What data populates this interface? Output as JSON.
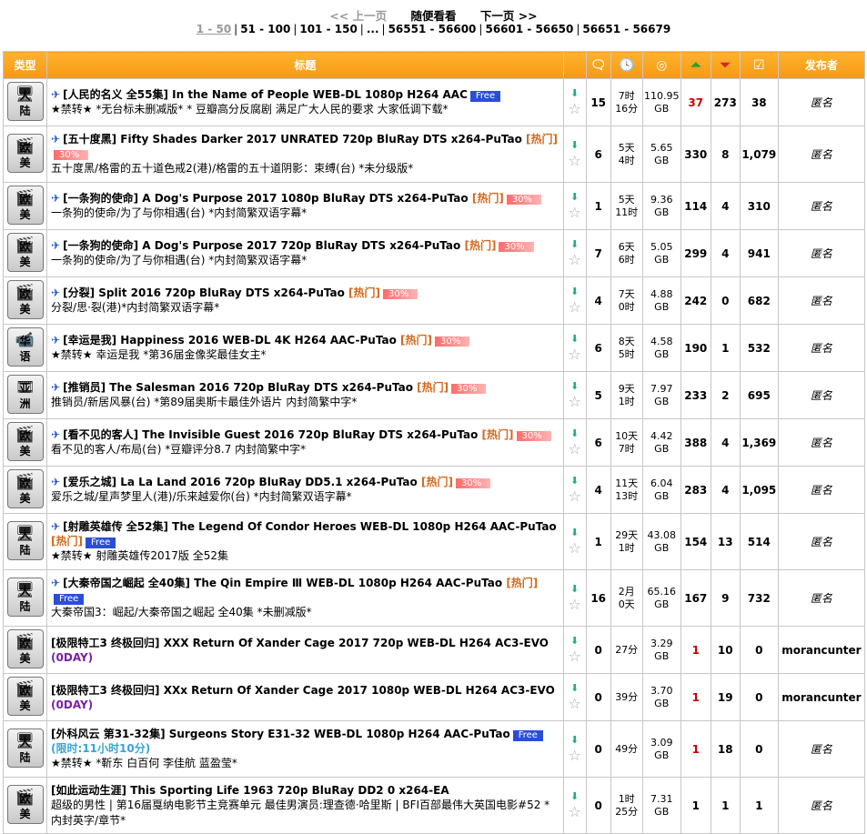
{
  "pager": {
    "prev": "<< 上一页",
    "random": "随便看看",
    "next": "下一页 >>",
    "pages": [
      "1 - 50",
      "51 - 100",
      "101 - 150",
      "...",
      "56551 - 56600",
      "56601 - 56650",
      "56651 - 56679"
    ]
  },
  "header": {
    "type": "类型",
    "title": "标题",
    "uploader": "发布者",
    "icons": [
      "comments-icon",
      "time-icon",
      "size-icon",
      "seeders-icon",
      "leechers-icon",
      "completed-icon"
    ]
  },
  "rows": [
    {
      "cat_icon": "tv-icon",
      "cat": "大陆",
      "title": "[人民的名义 全55集] In the Name of People WEB-DL 1080p H264 AAC",
      "hot": "",
      "free": "Free",
      "pct": "",
      "oday": "",
      "limit": "",
      "sub": "★禁转★ *无台标未删减版* * 豆瓣高分反腐剧 满足广大人民的要求 大家低调下载*",
      "comments": "15",
      "time1": "7时",
      "time2": "16分",
      "size1": "110.95",
      "size2": "GB",
      "seed": "37",
      "seed_red": true,
      "leech": "273",
      "done": "38",
      "uploader": "匿名"
    },
    {
      "cat_icon": "movie-icon",
      "cat": "欧美",
      "title": "[五十度黑] Fifty Shades Darker 2017 UNRATED 720p BluRay DTS x264-PuTao",
      "hot": "[热门]",
      "free": "",
      "pct": "30%",
      "oday": "",
      "limit": "",
      "sub": "五十度黑/格雷的五十道色戒2(港)/格雷的五十道阴影：束缚(台) *未分级版*",
      "comments": "6",
      "time1": "5天",
      "time2": "4时",
      "size1": "5.65",
      "size2": "GB",
      "seed": "330",
      "seed_red": false,
      "leech": "8",
      "done": "1,079",
      "uploader": "匿名"
    },
    {
      "cat_icon": "movie-icon",
      "cat": "欧美",
      "title": "[一条狗的使命] A Dog's Purpose 2017 1080p BluRay DTS x264-PuTao",
      "hot": "[热门]",
      "free": "",
      "pct": "30%",
      "oday": "",
      "limit": "",
      "sub": "一条狗的使命/为了与你相遇(台) *内封简繁双语字幕*",
      "comments": "1",
      "time1": "5天",
      "time2": "11时",
      "size1": "9.36",
      "size2": "GB",
      "seed": "114",
      "seed_red": false,
      "leech": "4",
      "done": "310",
      "uploader": "匿名"
    },
    {
      "cat_icon": "movie-icon",
      "cat": "欧美",
      "title": "[一条狗的使命] A Dog's Purpose 2017 720p BluRay DTS x264-PuTao",
      "hot": "[热门]",
      "free": "",
      "pct": "30%",
      "oday": "",
      "limit": "",
      "sub": "一条狗的使命/为了与你相遇(台) *内封简繁双语字幕*",
      "comments": "7",
      "time1": "6天",
      "time2": "6时",
      "size1": "5.05",
      "size2": "GB",
      "seed": "299",
      "seed_red": false,
      "leech": "4",
      "done": "941",
      "uploader": "匿名"
    },
    {
      "cat_icon": "movie-icon",
      "cat": "欧美",
      "title": "[分裂] Split 2016 720p BluRay DTS x264-PuTao",
      "hot": "[热门]",
      "free": "",
      "pct": "30%",
      "oday": "",
      "limit": "",
      "sub": "分裂/思·裂(港)*内封简繁双语字幕*",
      "comments": "4",
      "time1": "7天",
      "time2": "0时",
      "size1": "4.88",
      "size2": "GB",
      "seed": "242",
      "seed_red": false,
      "leech": "0",
      "done": "682",
      "uploader": "匿名"
    },
    {
      "cat_icon": "camera-icon",
      "cat": "华语",
      "title": "[幸运是我] Happiness 2016 WEB-DL 4K H264 AAC-PuTao",
      "hot": "[热门]",
      "free": "",
      "pct": "30%",
      "oday": "",
      "limit": "",
      "sub": "★禁转★ 幸运是我 *第36届金像奖最佳女主*",
      "comments": "6",
      "time1": "8天",
      "time2": "5时",
      "size1": "4.58",
      "size2": "GB",
      "seed": "190",
      "seed_red": false,
      "leech": "1",
      "done": "532",
      "uploader": "匿名"
    },
    {
      "cat_icon": "film-icon",
      "cat": "亚洲",
      "title": "[推销员] The Salesman 2016 720p BluRay DTS x264-PuTao",
      "hot": "[热门]",
      "free": "",
      "pct": "30%",
      "oday": "",
      "limit": "",
      "sub": "推销员/新居风暴(台) *第89届奥斯卡最佳外语片 内封简繁中字*",
      "comments": "5",
      "time1": "9天",
      "time2": "1时",
      "size1": "7.97",
      "size2": "GB",
      "seed": "233",
      "seed_red": false,
      "leech": "2",
      "done": "695",
      "uploader": "匿名"
    },
    {
      "cat_icon": "movie-icon",
      "cat": "欧美",
      "title": "[看不见的客人] The Invisible Guest 2016 720p BluRay DTS x264-PuTao",
      "hot": "[热门]",
      "free": "",
      "pct": "30%",
      "oday": "",
      "limit": "",
      "sub": "看不见的客人/布局(台) *豆瓣评分8.7 内封简繁中字*",
      "comments": "6",
      "time1": "10天",
      "time2": "7时",
      "size1": "4.42",
      "size2": "GB",
      "seed": "388",
      "seed_red": false,
      "leech": "4",
      "done": "1,369",
      "uploader": "匿名"
    },
    {
      "cat_icon": "movie-icon",
      "cat": "欧美",
      "title": "[爱乐之城] La La Land 2016 720p BluRay DD5.1 x264-PuTao",
      "hot": "[热门]",
      "free": "",
      "pct": "30%",
      "oday": "",
      "limit": "",
      "sub": "爱乐之城/星声梦里人(港)/乐来越爱你(台) *内封简繁双语字幕*",
      "comments": "4",
      "time1": "11天",
      "time2": "13时",
      "size1": "6.04",
      "size2": "GB",
      "seed": "283",
      "seed_red": false,
      "leech": "4",
      "done": "1,095",
      "uploader": "匿名"
    },
    {
      "cat_icon": "tv-icon",
      "cat": "大陆",
      "title": "[射雕英雄传 全52集] The Legend Of Condor Heroes WEB-DL 1080p H264 AAC-PuTao",
      "hot": "[热门]",
      "free": "Free",
      "pct": "",
      "oday": "",
      "limit": "",
      "sub": "★禁转★ 射雕英雄传2017版 全52集",
      "comments": "1",
      "time1": "29天",
      "time2": "1时",
      "size1": "43.08",
      "size2": "GB",
      "seed": "154",
      "seed_red": false,
      "leech": "13",
      "done": "514",
      "uploader": "匿名"
    },
    {
      "cat_icon": "tv-icon",
      "cat": "大陆",
      "title": "[大秦帝国之崛起 全40集] The Qin Empire Ⅲ WEB-DL 1080p H264 AAC-PuTao",
      "hot": "[热门]",
      "free": "Free",
      "pct": "",
      "oday": "",
      "limit": "",
      "sub": "大秦帝国3：崛起/大秦帝国之崛起 全40集 *未删减版*",
      "comments": "16",
      "time1": "2月",
      "time2": "0天",
      "size1": "65.16",
      "size2": "GB",
      "seed": "167",
      "seed_red": false,
      "leech": "9",
      "done": "732",
      "uploader": "匿名"
    },
    {
      "cat_icon": "movie-icon",
      "cat": "欧美",
      "title": "[极限特工3 终极回归] XXX Return Of Xander Cage 2017 720p WEB-DL H264 AC3-EVO",
      "hot": "",
      "free": "",
      "pct": "",
      "oday": "(0DAY)",
      "limit": "",
      "sub": "",
      "comments": "0",
      "time1": "27分",
      "time2": "",
      "size1": "3.29",
      "size2": "GB",
      "seed": "1",
      "seed_red": true,
      "leech": "10",
      "done": "0",
      "uploader": "morancunter"
    },
    {
      "cat_icon": "movie-icon",
      "cat": "欧美",
      "title": "[极限特工3 终极回归] XXx Return Of Xander Cage 2017 1080p WEB-DL H264 AC3-EVO",
      "hot": "",
      "free": "",
      "pct": "",
      "oday": "(0DAY)",
      "limit": "",
      "sub": "",
      "comments": "0",
      "time1": "39分",
      "time2": "",
      "size1": "3.70",
      "size2": "GB",
      "seed": "1",
      "seed_red": true,
      "leech": "19",
      "done": "0",
      "uploader": "morancunter"
    },
    {
      "cat_icon": "tv-icon",
      "cat": "大陆",
      "title": "[外科风云 第31-32集] Surgeons Story E31-32 WEB-DL 1080p H264 AAC-PuTao",
      "hot": "",
      "free": "Free",
      "pct": "",
      "oday": "",
      "limit": "(限时:11小时10分)",
      "sub": "★禁转★ *靳东 白百何 李佳航 蓝盈莹*",
      "comments": "0",
      "time1": "49分",
      "time2": "",
      "size1": "3.09",
      "size2": "GB",
      "seed": "1",
      "seed_red": true,
      "leech": "18",
      "done": "0",
      "uploader": "匿名"
    },
    {
      "cat_icon": "movie-icon",
      "cat": "欧美",
      "title": "[如此运动生涯] This Sporting Life 1963 720p BluRay DD2 0 x264-EA",
      "hot": "",
      "free": "",
      "pct": "",
      "oday": "",
      "limit": "",
      "sub": "超级的男性 | 第16届戛纳电影节主竞赛单元 最佳男演员:理查德·哈里斯 | BFI百部最伟大英国电影#52 *内封英字/章节*",
      "comments": "0",
      "time1": "1时",
      "time2": "25分",
      "size1": "7.31",
      "size2": "GB",
      "seed": "1",
      "seed_red": false,
      "leech": "1",
      "done": "1",
      "uploader": "匿名"
    }
  ]
}
